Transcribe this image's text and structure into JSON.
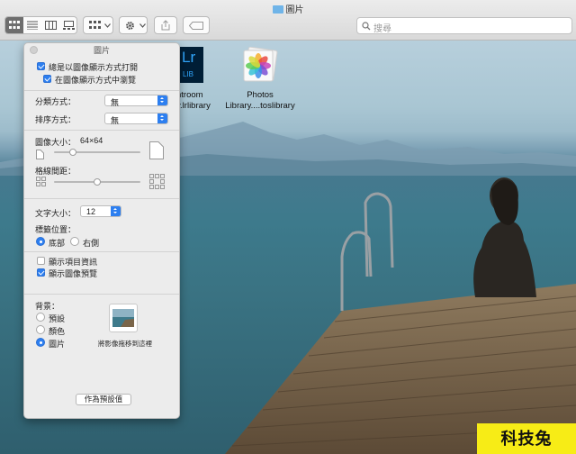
{
  "window": {
    "title": "圖片"
  },
  "toolbar": {
    "view_icons": [
      "icon-view-icon",
      "list-view-icon",
      "column-view-icon",
      "gallery-view-icon"
    ],
    "arrange_icon": "grid-arrange-icon",
    "action_icon": "gear-icon",
    "share_icon": "share-icon",
    "tag_icon": "tag-icon",
    "search_placeholder": "搜尋"
  },
  "desktop": {
    "items": [
      {
        "label_line1": "ntroom",
        "label_line2": "y.lrlibrary",
        "icon": "lightroom-library-icon",
        "icon_text_top": "Lr",
        "icon_text_bottom": "LIB"
      },
      {
        "label_line1": "Photos",
        "label_line2": "Library....toslibrary",
        "icon": "photos-library-icon"
      }
    ]
  },
  "view_options": {
    "title": "圖片",
    "always_open_label": "總是以圖像顯示方式打開",
    "always_open_checked": true,
    "browse_label": "在圖像顯示方式中瀏覽",
    "browse_checked": true,
    "group_by_label": "分類方式：",
    "group_by_value": "無",
    "sort_by_label": "排序方式：",
    "sort_by_value": "無",
    "icon_size_label": "圖像大小：",
    "icon_size_value": "64×64",
    "icon_size_fraction": 0.22,
    "grid_spacing_label": "格線間距：",
    "grid_spacing_fraction": 0.5,
    "text_size_label": "文字大小：",
    "text_size_value": "12",
    "label_position_label": "標籤位置：",
    "label_bottom": "底部",
    "label_right": "右側",
    "label_position_selected": "bottom",
    "show_item_info_label": "顯示項目資訊",
    "show_item_info_checked": false,
    "show_icon_preview_label": "顯示圖像預覽",
    "show_icon_preview_checked": true,
    "background_label": "背景：",
    "bg_default": "預設",
    "bg_color": "顏色",
    "bg_picture": "圖片",
    "background_selected": "picture",
    "drag_image_hint": "將影像拖移到這裡",
    "use_defaults_button": "作為預設值"
  },
  "watermark": {
    "text": "科技兔"
  },
  "colors": {
    "accent": "#2d7ff0",
    "watermark_bg": "#f7ec16"
  }
}
